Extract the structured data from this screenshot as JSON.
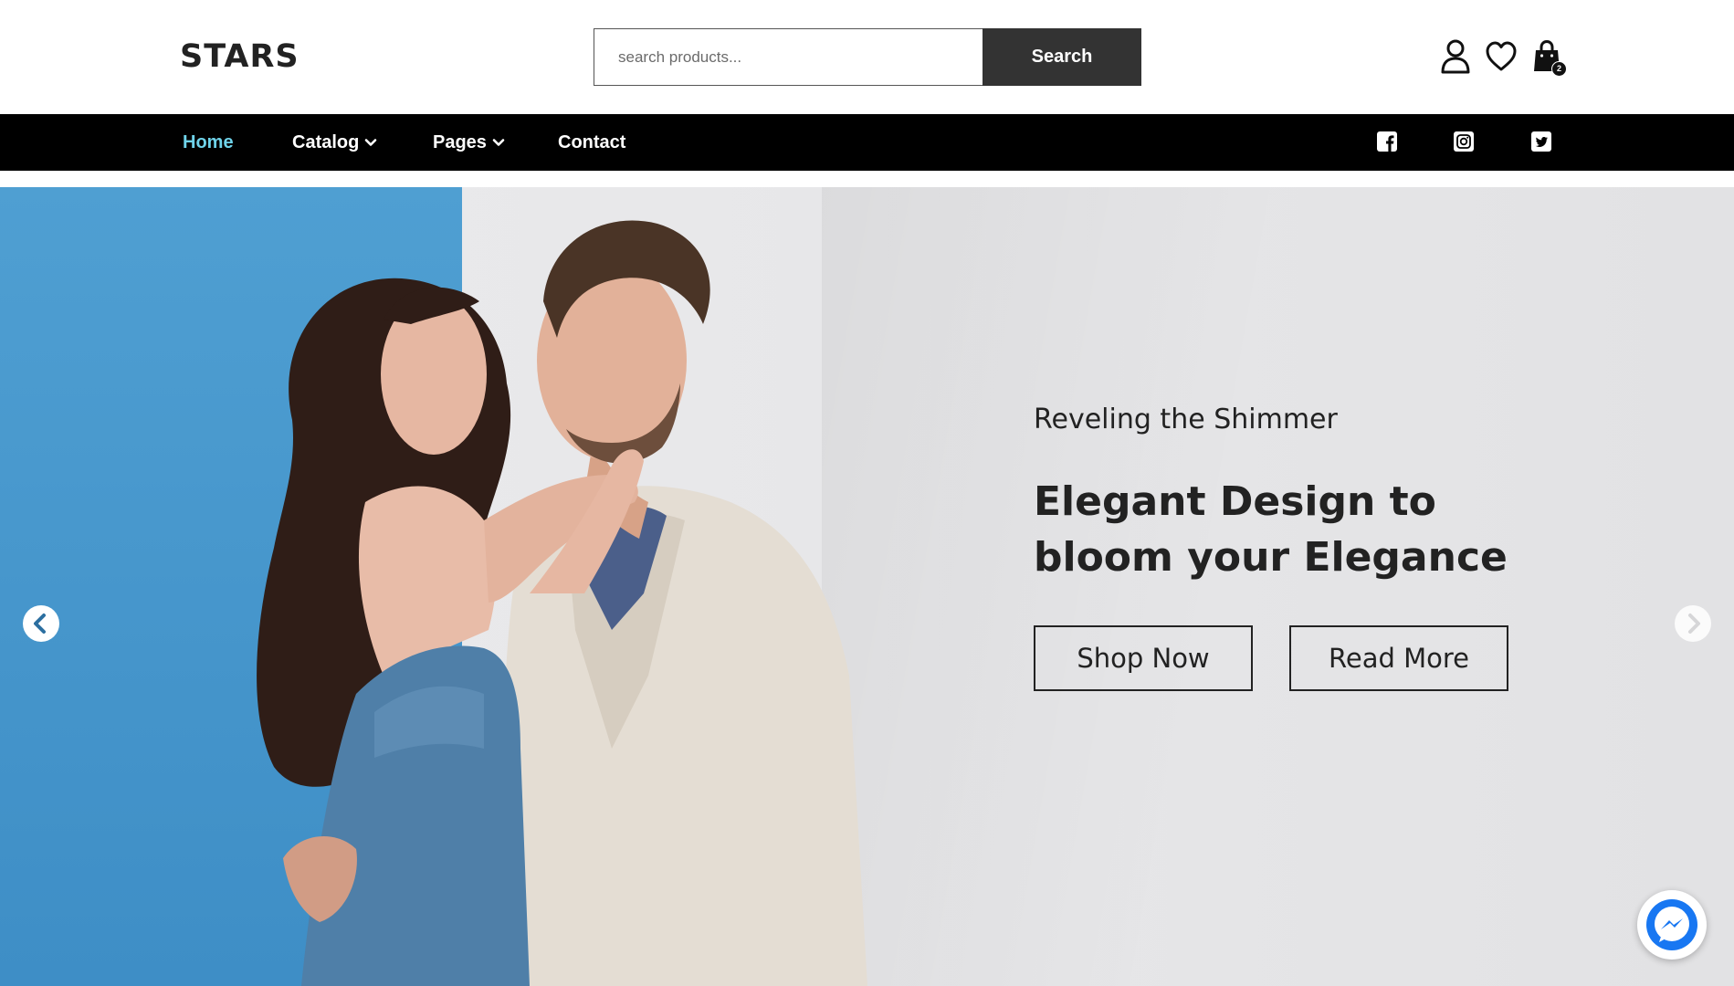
{
  "site": {
    "logo": "STARS"
  },
  "search": {
    "placeholder": "search products...",
    "button_label": "Search"
  },
  "header_icons": {
    "user": "user-icon",
    "wishlist": "heart-icon",
    "cart": "shopping-bag-icon",
    "cart_count": "2"
  },
  "nav": {
    "items": [
      {
        "label": "Home",
        "active": true
      },
      {
        "label": "Catalog",
        "dropdown": true
      },
      {
        "label": "Pages",
        "dropdown": true
      },
      {
        "label": "Contact"
      }
    ],
    "social": [
      "facebook-icon",
      "instagram-icon",
      "twitter-icon"
    ]
  },
  "hero": {
    "subtitle": "Reveling the Shimmer",
    "title": "Elegant Design to bloom your Elegance",
    "primary_button": "Shop Now",
    "secondary_button": "Read More"
  },
  "colors": {
    "nav_background": "#000000",
    "nav_active": "#6fd3ea",
    "search_button": "#333333",
    "hero_blue": "#4a9ad0",
    "messenger": "#1877f2"
  }
}
